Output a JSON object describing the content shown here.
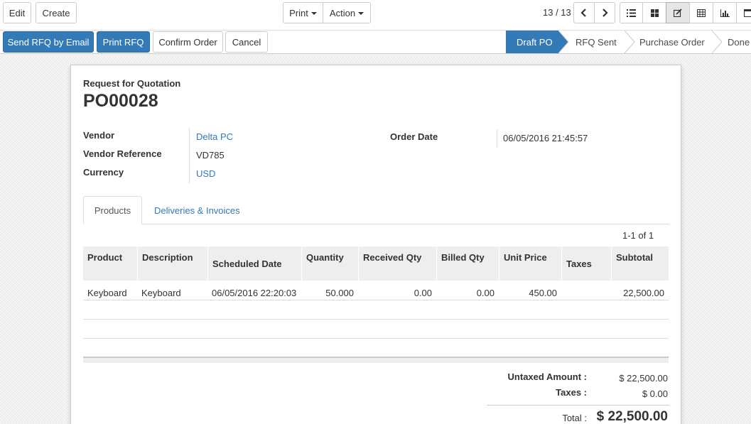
{
  "toolbar": {
    "edit_label": "Edit",
    "create_label": "Create",
    "print_label": "Print",
    "action_label": "Action",
    "pager_value": "13 / 13"
  },
  "view_switcher": [
    "list-icon",
    "kanban-icon",
    "form-icon",
    "pivot-icon",
    "graph-icon",
    "calendar-icon"
  ],
  "actions": {
    "send_rfq": "Send RFQ by Email",
    "print_rfq": "Print RFQ",
    "confirm_order": "Confirm Order",
    "cancel": "Cancel"
  },
  "statusbar": {
    "stages": [
      "Draft PO",
      "RFQ Sent",
      "Purchase Order",
      "Done"
    ],
    "active": "Draft PO"
  },
  "document": {
    "type_label": "Request for Quotation",
    "name": "PO00028",
    "vendor_label": "Vendor",
    "vendor_value": "Delta PC",
    "vendor_ref_label": "Vendor Reference",
    "vendor_ref_value": "VD785",
    "currency_label": "Currency",
    "currency_value": "USD",
    "order_date_label": "Order Date",
    "order_date_value": "06/05/2016 21:45:57"
  },
  "tabs": [
    {
      "label": "Products",
      "active": true
    },
    {
      "label": "Deliveries & Invoices",
      "active": false
    }
  ],
  "lines_pager": "1-1 of 1",
  "table": {
    "headers": {
      "product": "Product",
      "description": "Description",
      "scheduled_date": "Scheduled Date",
      "quantity": "Quantity",
      "received_qty": "Received Qty",
      "billed_qty": "Billed Qty",
      "unit_price": "Unit Price",
      "taxes": "Taxes",
      "subtotal": "Subtotal"
    },
    "rows": [
      {
        "product": "Keyboard",
        "description": "Keyboard",
        "scheduled_date": "06/05/2016 22:20:03",
        "quantity": "50.000",
        "received_qty": "0.00",
        "billed_qty": "0.00",
        "unit_price": "450.00",
        "taxes": "",
        "subtotal": "22,500.00"
      }
    ]
  },
  "totals": {
    "untaxed_label": "Untaxed Amount :",
    "untaxed_value": "$ 22,500.00",
    "taxes_label": "Taxes :",
    "taxes_value": "$ 0.00",
    "total_label": "Total :",
    "total_value": "$ 22,500.00"
  },
  "colors": {
    "primary": "#337ab7",
    "link": "#337ab7"
  }
}
